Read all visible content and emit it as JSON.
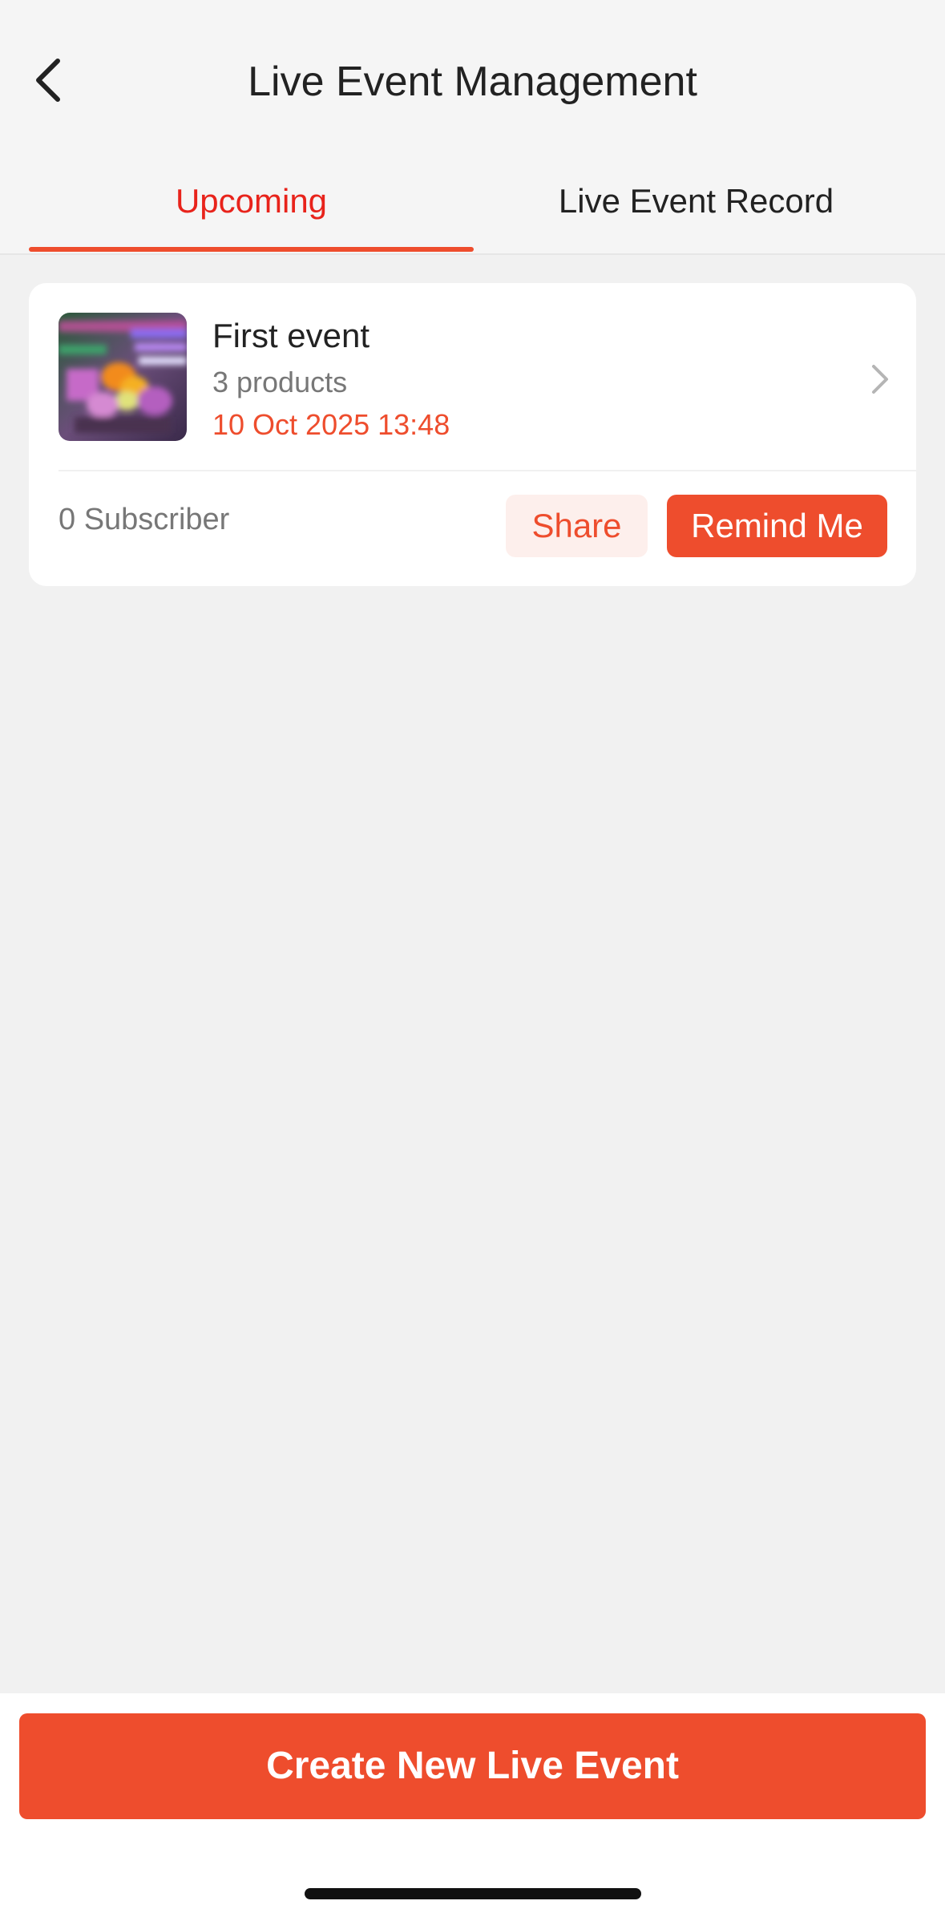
{
  "header": {
    "title": "Live Event Management",
    "back_icon": "chevron-left-icon"
  },
  "tabs": [
    {
      "label": "Upcoming",
      "active": true
    },
    {
      "label": "Live Event Record",
      "active": false
    }
  ],
  "event_card": {
    "name": "First event",
    "products": "3 products",
    "datetime": "10 Oct 2025 13:48",
    "subscribers": "0 Subscriber",
    "share_label": "Share",
    "remind_label": "Remind Me",
    "chevron_icon": "chevron-right-icon"
  },
  "footer": {
    "create_label": "Create New Live Event"
  },
  "colors": {
    "accent": "#ee4d2d",
    "active_tab_text": "#e8231b",
    "share_bg": "#fdefec"
  }
}
